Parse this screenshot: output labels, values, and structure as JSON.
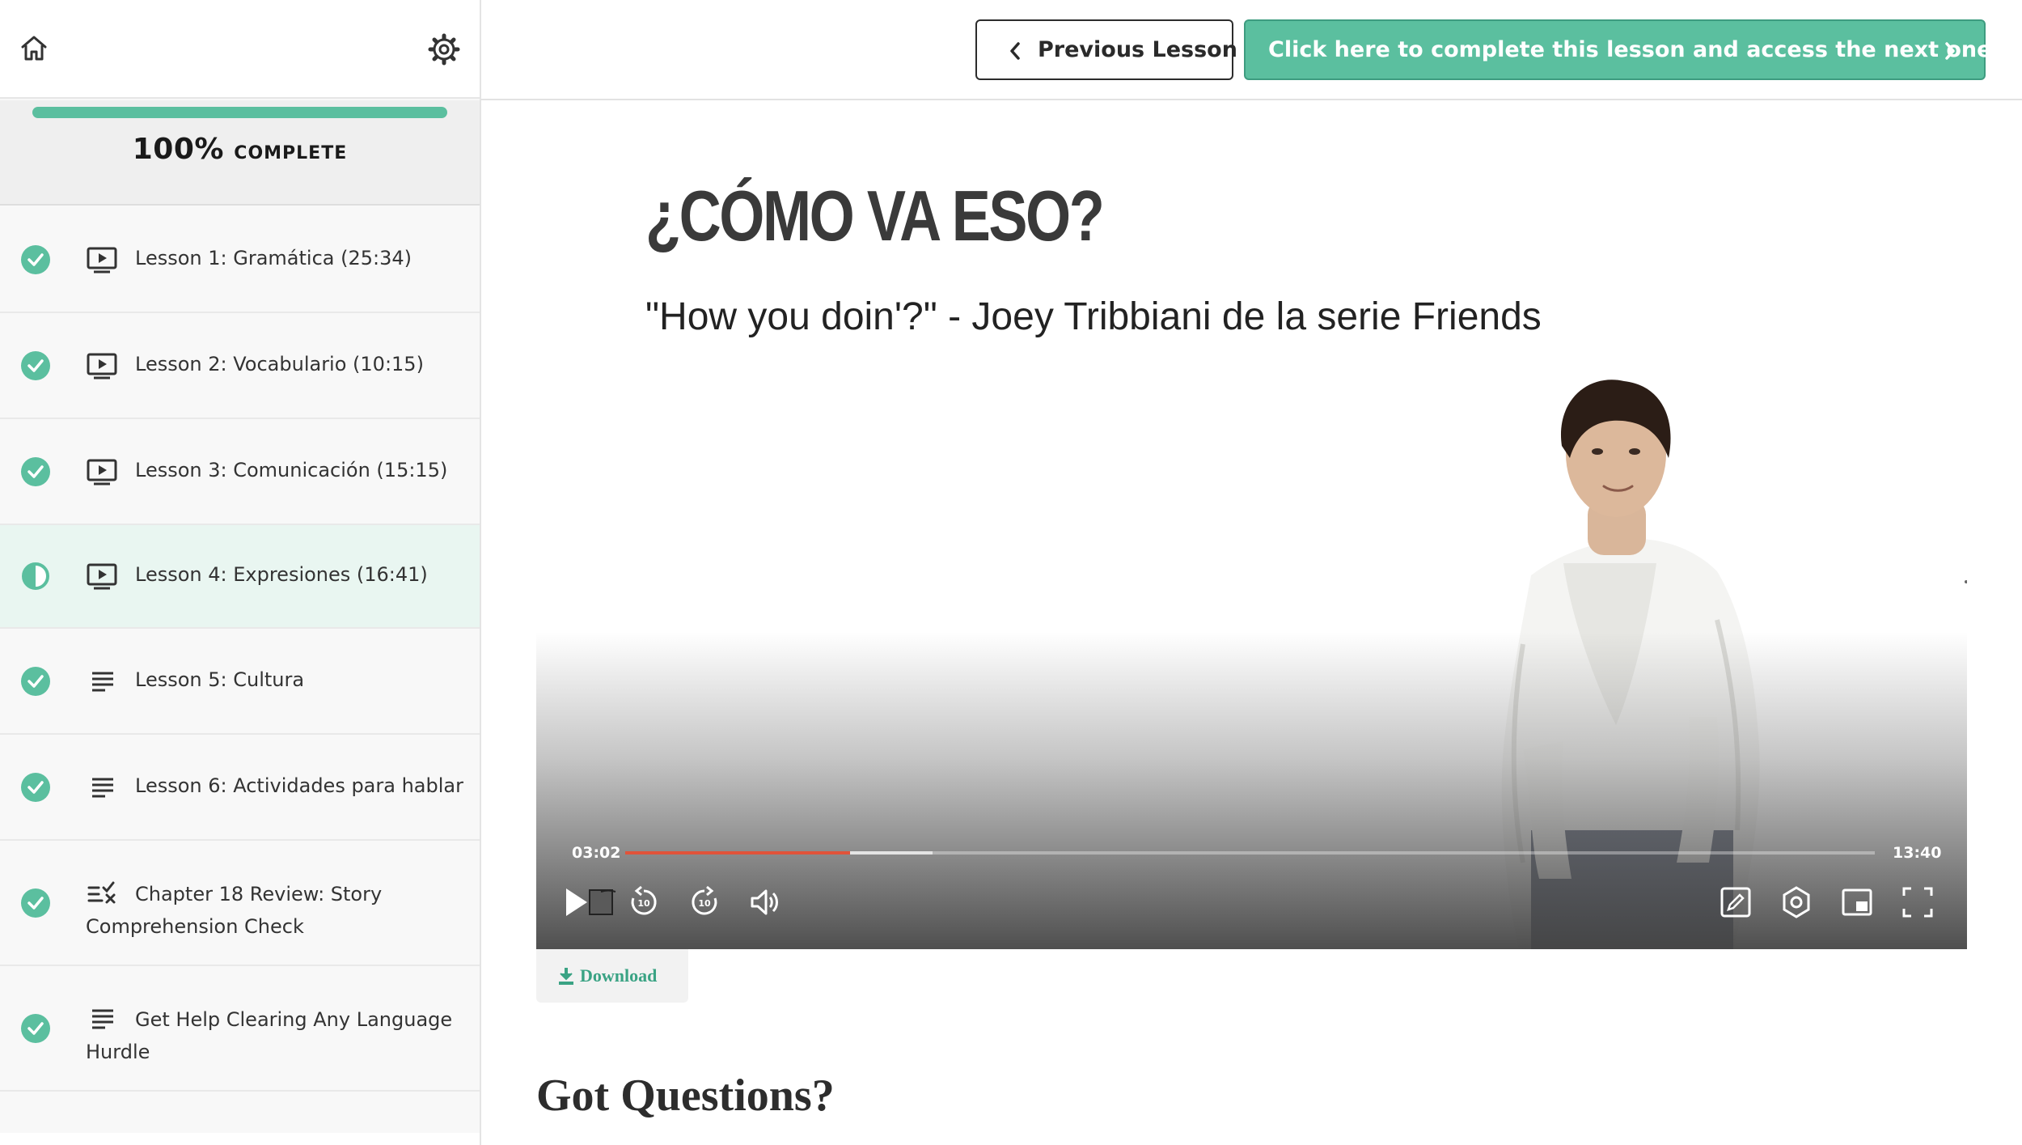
{
  "sidebar": {
    "progress_percent": "100%",
    "progress_label": "COMPLETE",
    "progress_value": 1.0,
    "lessons": [
      {
        "title": "Lesson 1: Gramática (25:34)",
        "type": "video",
        "status": "complete"
      },
      {
        "title": "Lesson 2: Vocabulario (10:15)",
        "type": "video",
        "status": "complete"
      },
      {
        "title": "Lesson 3: Comunicación (15:15)",
        "type": "video",
        "status": "complete"
      },
      {
        "title": "Lesson 4: Expresiones (16:41)",
        "type": "video",
        "status": "in-progress"
      },
      {
        "title": "Lesson 5: Cultura",
        "type": "text",
        "status": "complete"
      },
      {
        "title": "Lesson 6: Actividades para hablar",
        "type": "text",
        "status": "complete"
      },
      {
        "title": "Chapter 18 Review: Story Comprehension Check",
        "type": "quiz",
        "status": "complete"
      },
      {
        "title": "Get Help Clearing Any Language Hurdle",
        "type": "text",
        "status": "complete"
      }
    ]
  },
  "header": {
    "prev_label": "Previous Lesson",
    "next_label": "Click here to complete this lesson and access the next one →"
  },
  "video": {
    "heading": "¿CÓMO VA ESO?",
    "subtitle": "\"How you doin'?\" - Joey Tribbiani de la serie Friends",
    "current_time": "03:02",
    "total_time": "13:40",
    "played_fraction": 0.18,
    "buffered_fraction": 0.246
  },
  "download_label": "Download",
  "section_heading": "Got Questions?",
  "colors": {
    "accent": "#5bbf9f",
    "progress_played": "#e0533a",
    "top_line": "#2d6b6b"
  },
  "icons": {
    "home": "home-icon",
    "settings": "gear-icon",
    "video_lesson": "video-play-icon",
    "text_lesson": "text-lines-icon",
    "quiz_lesson": "quiz-checklist-icon"
  }
}
